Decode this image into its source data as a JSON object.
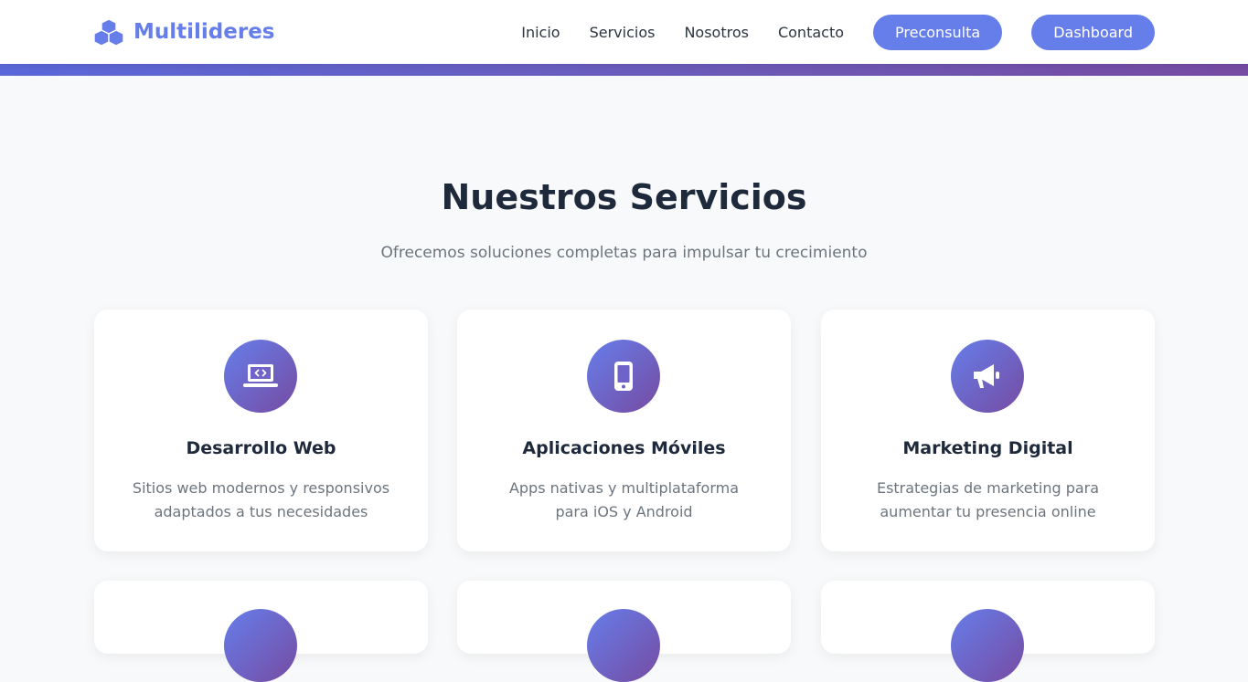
{
  "navbar": {
    "brand": "Multilideres",
    "links": [
      "Inicio",
      "Servicios",
      "Nosotros",
      "Contacto"
    ],
    "buttons": [
      "Preconsulta",
      "Dashboard"
    ]
  },
  "services": {
    "title": "Nuestros Servicios",
    "subtitle": "Ofrecemos soluciones completas para impulsar tu crecimiento",
    "cards": [
      {
        "icon": "laptop-code-icon",
        "title": "Desarrollo Web",
        "description": "Sitios web modernos y responsivos adaptados a tus necesidades"
      },
      {
        "icon": "mobile-phone-icon",
        "title": "Aplicaciones Móviles",
        "description": "Apps nativas y multiplataforma para iOS y Android"
      },
      {
        "icon": "megaphone-icon",
        "title": "Marketing Digital",
        "description": "Estrategias de marketing para aumentar tu presencia online"
      }
    ]
  },
  "colors": {
    "primary": "#667eea",
    "gradient_end": "#764ba2",
    "heading": "#1e2a3b",
    "muted": "#6c757d",
    "background": "#f8f9fa"
  }
}
